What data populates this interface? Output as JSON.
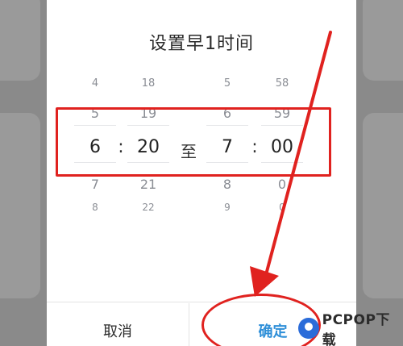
{
  "dialog": {
    "title": "设置早1时间",
    "separator": ":",
    "to_label": "至",
    "cancel_label": "取消",
    "confirm_label": "确定"
  },
  "picker": {
    "start_hour": [
      "4",
      "5",
      "6",
      "7",
      "8"
    ],
    "start_minute": [
      "18",
      "19",
      "20",
      "21",
      "22"
    ],
    "end_hour": [
      "5",
      "6",
      "7",
      "8",
      "9"
    ],
    "end_minute": [
      "58",
      "59",
      "00",
      "0",
      "0"
    ]
  },
  "selected": {
    "start_hour": "6",
    "start_minute": "20",
    "end_hour": "7",
    "end_minute": "00"
  },
  "watermark": {
    "text": "PCPOP下载"
  },
  "colors": {
    "annotation": "#e0221f",
    "accent": "#2f8fd8"
  }
}
